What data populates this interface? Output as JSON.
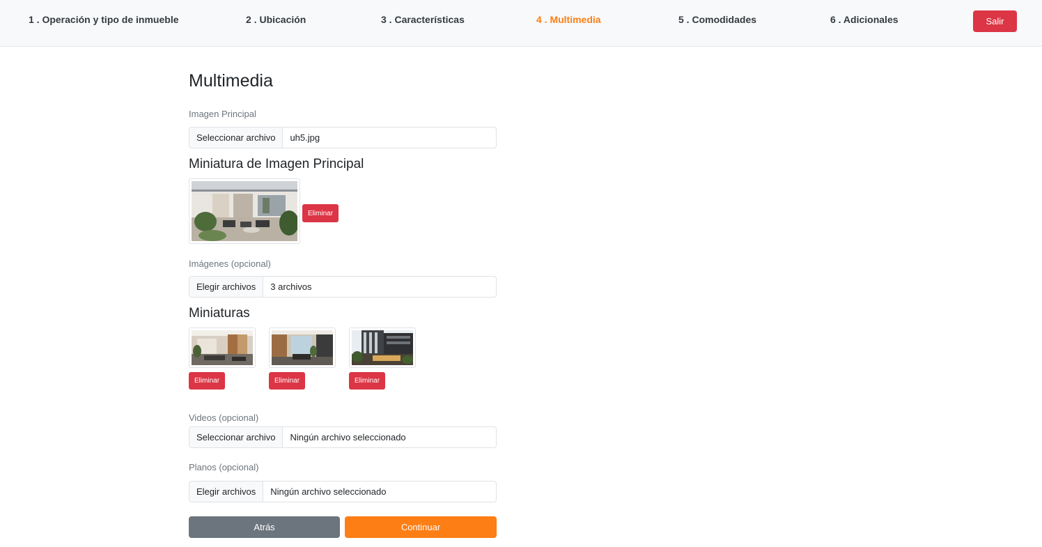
{
  "stepper": {
    "steps": [
      {
        "label": "1 . Operación y tipo de inmueble"
      },
      {
        "label": "2 . Ubicación"
      },
      {
        "label": "3 . Características"
      },
      {
        "label": "4 . Multimedia"
      },
      {
        "label": "5 . Comodidades"
      },
      {
        "label": "6 . Adicionales"
      }
    ],
    "active_step": 4,
    "exit_label": "Salir"
  },
  "page": {
    "title": "Multimedia"
  },
  "main_image": {
    "label": "Imagen Principal",
    "button_label": "Seleccionar archivo",
    "file_name": "uh5.jpg"
  },
  "main_thumbnail": {
    "title": "Miniatura de Imagen Principal",
    "delete_label": "Eliminar"
  },
  "images": {
    "label": "Imágenes (opcional)",
    "button_label": "Elegir archivos",
    "file_name": "3 archivos"
  },
  "thumbnails": {
    "title": "Miniaturas",
    "items": [
      {
        "delete_label": "Eliminar"
      },
      {
        "delete_label": "Eliminar"
      },
      {
        "delete_label": "Eliminar"
      }
    ]
  },
  "videos": {
    "label": "Videos (opcional)",
    "button_label": "Seleccionar archivo",
    "file_name": "Ningún archivo seleccionado"
  },
  "plans": {
    "label": "Planos (opcional)",
    "button_label": "Elegir archivos",
    "file_name": "Ningún archivo seleccionado"
  },
  "actions": {
    "back_label": "Atrás",
    "continue_label": "Continuar"
  },
  "colors": {
    "accent": "#fd7e14",
    "danger": "#dc3545",
    "secondary": "#6c757d"
  }
}
